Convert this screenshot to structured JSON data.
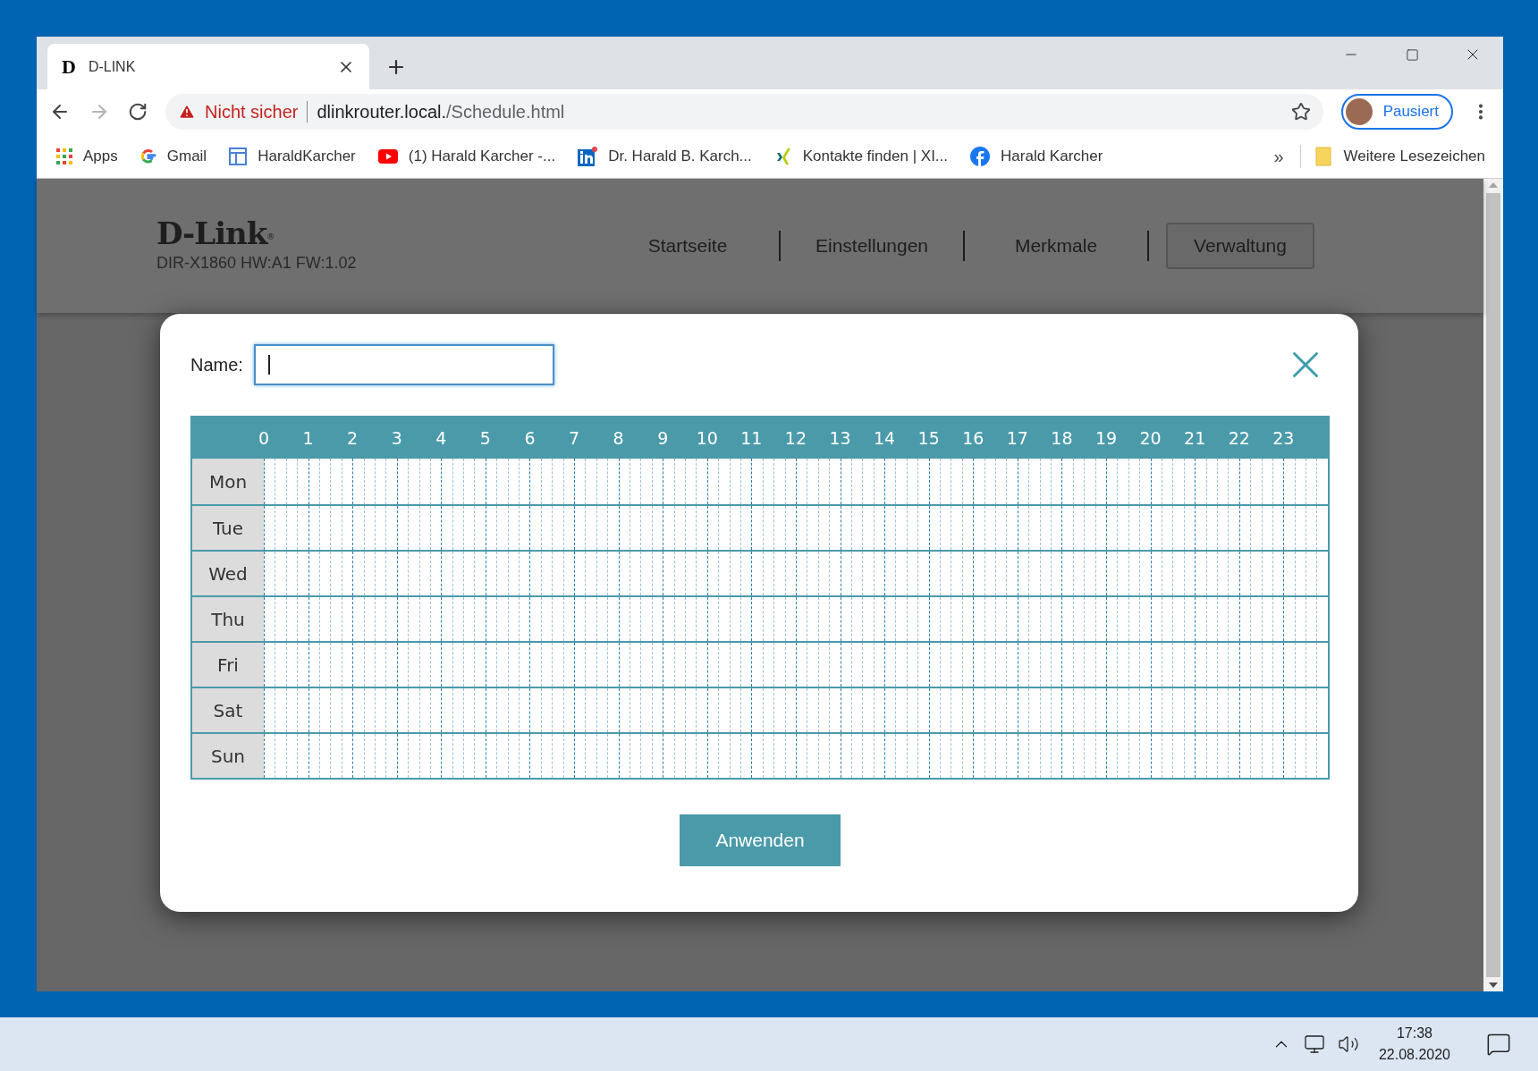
{
  "tab": {
    "favicon_letter": "D",
    "title": "D-LINK",
    "selected": true
  },
  "toolbar": {
    "security": "Nicht sicher",
    "url_host": "dlinkrouter.local.",
    "url_path": "/Schedule.html",
    "forward_disabled": true,
    "profile": "Pausiert"
  },
  "bookmarks": [
    {
      "kind": "apps",
      "label": "Apps"
    },
    {
      "kind": "google",
      "label": "Gmail"
    },
    {
      "kind": "page",
      "label": "HaraldKarcher"
    },
    {
      "kind": "youtube",
      "label": "(1) Harald Karcher -..."
    },
    {
      "kind": "linkedin",
      "label": "Dr. Harald B. Karch..."
    },
    {
      "kind": "xing",
      "label": "Kontakte finden | XI..."
    },
    {
      "kind": "facebook",
      "label": "Harald Karcher"
    }
  ],
  "bookmarks_more": "»",
  "other_bookmarks": "Weitere Lesezeichen",
  "router": {
    "logo": "D-Link",
    "logo_mark": "®",
    "model": "DIR-X1860 HW:A1 FW:1.02",
    "nav": [
      {
        "label": "Startseite",
        "selected": false
      },
      {
        "label": "Einstellungen",
        "selected": false
      },
      {
        "label": "Merkmale",
        "selected": false
      },
      {
        "label": "Verwaltung",
        "selected": true
      }
    ]
  },
  "dialog": {
    "name_label": "Name:",
    "hours": [
      "0",
      "1",
      "2",
      "3",
      "4",
      "5",
      "6",
      "7",
      "8",
      "9",
      "10",
      "11",
      "12",
      "13",
      "14",
      "15",
      "16",
      "17",
      "18",
      "19",
      "20",
      "21",
      "22",
      "23"
    ],
    "days": [
      "Mon",
      "Tue",
      "Wed",
      "Thu",
      "Fri",
      "Sat",
      "Sun"
    ],
    "apply_button": "Anwenden"
  },
  "taskbar": {
    "time": "17:38",
    "date": "22.08.2020"
  }
}
